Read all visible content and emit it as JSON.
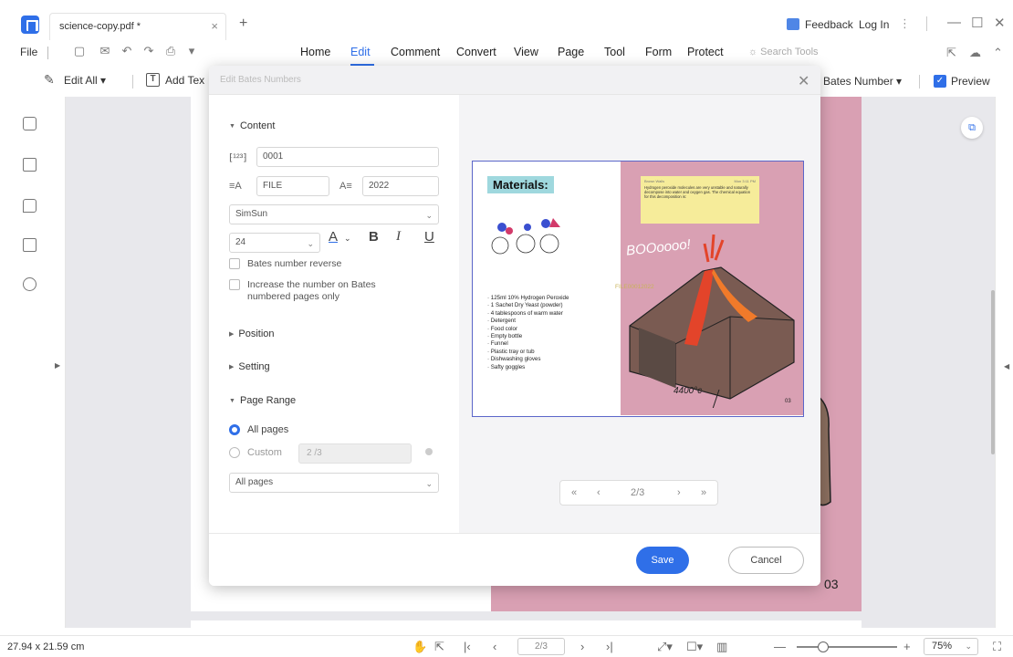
{
  "titlebar": {
    "tab_name": "science-copy.pdf *",
    "close": "×",
    "new_tab": "+",
    "feedback": "Feedback",
    "login": "Log In",
    "more": "⋮",
    "minimize": "—",
    "maximize": "☐",
    "close_window": "✕"
  },
  "menubar": {
    "file": "File",
    "items": [
      "Home",
      "Edit",
      "Comment",
      "Convert",
      "View",
      "Page",
      "Tool",
      "Form",
      "Protect"
    ],
    "active": "Edit",
    "search_placeholder": "Search Tools"
  },
  "toolbar": {
    "edit_all": "Edit All",
    "add_text": "Add Tex",
    "bates_number": "Bates Number",
    "preview": "Preview",
    "preview_checked": true
  },
  "dialog": {
    "title": "Edit Bates Numbers",
    "content_section": "Content",
    "start_number": "0001",
    "prefix": "FILE",
    "suffix": "2022",
    "font": "SimSun",
    "font_size": "24",
    "bold": "B",
    "italic": "I",
    "underline": "U",
    "font_color_glyph": "A",
    "reverse_label": "Bates number reverse",
    "increase_label": "Increase the number on Bates numbered pages only",
    "position_section": "Position",
    "setting_section": "Setting",
    "page_range_section": "Page Range",
    "all_pages_label": "All pages",
    "custom_label": "Custom",
    "custom_placeholder": "2 /3",
    "range_select": "All pages",
    "pager_text": "2/3",
    "save": "Save",
    "cancel": "Cancel"
  },
  "preview_page": {
    "title": "Materials:",
    "items": [
      "125ml 10% Hydrogen Peroxide",
      "1 Sachet Dry Yeast (powder)",
      "4 tablespoons of warm water",
      "Detergent",
      "Food color",
      "Empty bottle",
      "Funnel",
      "Plastic tray or tub",
      "Dishwashing gloves",
      "Safty goggles"
    ],
    "note_heading": "Brown Walls",
    "note_date": "Mon 3:11 PM",
    "note_body": "Hydrogen peroxide molecules are very unstable and naturally decompose into water and oxygen gas. The chemical equation for this decomposition is:",
    "boo": "BOOoooo!",
    "bates_stamp": "FILE00012022",
    "temperature": "4400°c",
    "page_number": "03",
    "colors": {
      "teal_highlight": "#9fd8de",
      "pink": "#d9a0b3",
      "note_yellow": "#f6ec9a"
    }
  },
  "document": {
    "page_number": "03"
  },
  "statusbar": {
    "dimensions": "27.94 x 21.59 cm",
    "page_input": "2/3",
    "zoom": "75%",
    "zoom_level_fraction": 0.2
  },
  "colors": {
    "accent": "#2f6fe8",
    "page_pink": "#d9a0b3"
  }
}
